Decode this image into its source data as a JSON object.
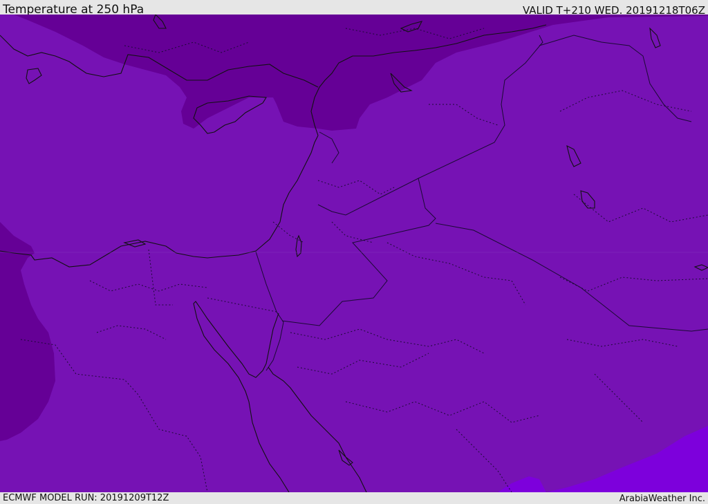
{
  "header": {
    "title": "Temperature at 250 hPa",
    "valid": "VALID T+210 WED. 20191218T06Z"
  },
  "footer": {
    "model_run": "ECMWF MODEL RUN: 20191209T12Z",
    "credit": "ArabiaWeather Inc."
  },
  "map": {
    "field_colors": {
      "base": "#7612b4",
      "cold": "#650096",
      "warm": "#7d00dc"
    },
    "line_colors": {
      "coast": "#111111",
      "border": "#1a0a33"
    }
  }
}
